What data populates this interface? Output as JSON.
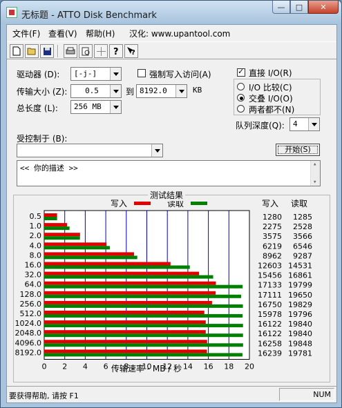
{
  "window": {
    "title": "无标题 - ATTO Disk Benchmark",
    "controls": {
      "minimize": "—",
      "maximize": "□",
      "close": "✕"
    }
  },
  "menu": [
    "文件(F)",
    "查看(V)",
    "帮助(H)",
    "汉化: www.upantool.com"
  ],
  "toolbar": {
    "icons": [
      "new-document-icon",
      "open-folder-icon",
      "save-icon",
      "print-icon",
      "print-preview-icon",
      "move-icon",
      "help-icon",
      "context-help-icon"
    ]
  },
  "form": {
    "drive_label": "驱动器 (D):",
    "drive_value": "[-j-]",
    "force_write_label": "强制写入访问(A)",
    "transfer_size_label": "传输大小 (Z):",
    "transfer_from": "0.5",
    "to_label": "到",
    "transfer_to": "8192.0",
    "transfer_unit": "KB",
    "total_length_label": "总长度 (L):",
    "total_length_value": "256 MB",
    "controlled_by_label": "受控制于 (B):",
    "controlled_by_value": "",
    "description": "<<  你的描述  >>",
    "direct_io_label": "直接 I/O(R)",
    "io_compare_label": "I/O 比较(C)",
    "overlap_io_label": "交叠 I/O(O)",
    "neither_label": "两者都不(N)",
    "queue_depth_label": "队列深度(Q):",
    "queue_depth_value": "4",
    "start_button": "开始(S)"
  },
  "results": {
    "title": "测试结果",
    "legend_write": "写入",
    "legend_read": "读取",
    "col_write": "写入",
    "col_read": "读取"
  },
  "colors": {
    "write": "#e00000",
    "read": "#008000",
    "grid": "#0000c0"
  },
  "chart_data": {
    "type": "bar",
    "orientation": "horizontal",
    "title": "测试结果",
    "xlabel": "传输速率 - MB / 秒",
    "xlim": [
      0,
      20
    ],
    "xticks": [
      0,
      2,
      4,
      6,
      8,
      10,
      12,
      14,
      16,
      18,
      20
    ],
    "categories": [
      "0.5",
      "1.0",
      "2.0",
      "4.0",
      "8.0",
      "16.0",
      "32.0",
      "64.0",
      "128.0",
      "256.0",
      "512.0",
      "1024.0",
      "2048.0",
      "4096.0",
      "8192.0"
    ],
    "series": [
      {
        "name": "写入",
        "values_kb": [
          1280,
          2275,
          3575,
          6219,
          8962,
          12603,
          15456,
          17133,
          17111,
          16750,
          15978,
          16122,
          16122,
          16258,
          16239
        ]
      },
      {
        "name": "读取",
        "values_kb": [
          1285,
          2528,
          3566,
          6546,
          9287,
          14531,
          16861,
          19799,
          19650,
          19829,
          19796,
          19840,
          19840,
          19848,
          19781
        ]
      }
    ]
  },
  "status": {
    "text": "要获得帮助, 请按 F1",
    "indicator": "NUM"
  }
}
